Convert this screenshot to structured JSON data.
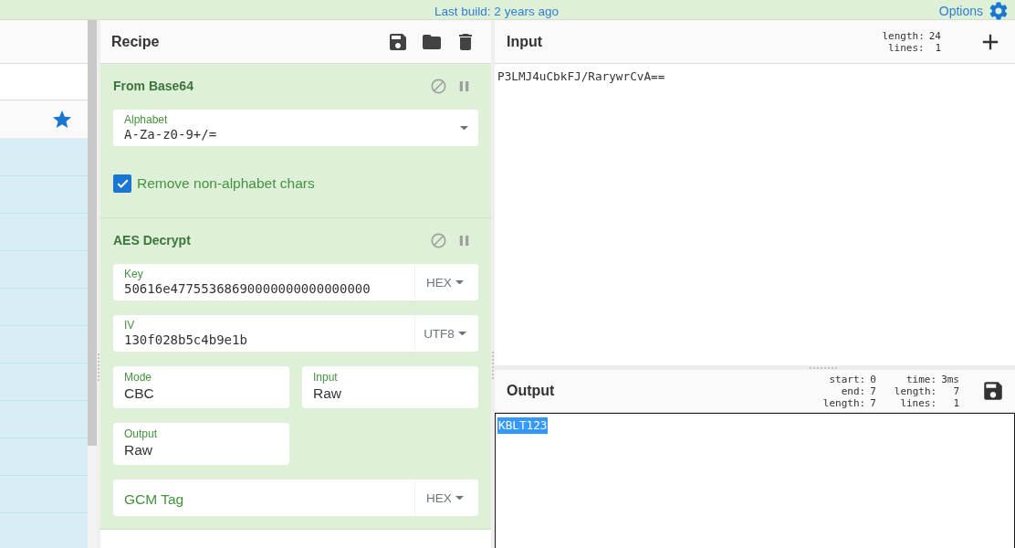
{
  "banner": {
    "build_info": "Last build: 2 years ago",
    "options_label": "Options"
  },
  "recipe": {
    "title": "Recipe",
    "operations": [
      {
        "name": "From Base64",
        "args": [
          {
            "kind": "editable_option",
            "label": "Alphabet",
            "value": "A-Za-z0-9+/="
          },
          {
            "kind": "checkbox",
            "label": "Remove non-alphabet chars",
            "checked": true
          }
        ]
      },
      {
        "name": "AES Decrypt",
        "args": [
          {
            "kind": "toggle_string",
            "label": "Key",
            "value": "50616e47755368690000000000000000",
            "format": "HEX"
          },
          {
            "kind": "toggle_string",
            "label": "IV",
            "value": "130f028b5c4b9e1b",
            "format": "UTF8"
          },
          {
            "kind": "option",
            "label": "Mode",
            "value": "CBC"
          },
          {
            "kind": "option",
            "label": "Input",
            "value": "Raw"
          },
          {
            "kind": "option",
            "label": "Output",
            "value": "Raw"
          },
          {
            "kind": "toggle_string",
            "placeholder": "GCM Tag",
            "format": "HEX"
          }
        ]
      }
    ]
  },
  "input": {
    "title": "Input",
    "stats": [
      [
        {
          "label": "length:",
          "value": "24"
        },
        {
          "label": "lines:",
          "value": "1"
        }
      ]
    ],
    "value": "P3LMJ4uCbkFJ/RarywrCvA=="
  },
  "output": {
    "title": "Output",
    "stats": [
      [
        {
          "label": "start:",
          "value": "0"
        },
        {
          "label": "end:",
          "value": "7"
        },
        {
          "label": "length:",
          "value": "7"
        }
      ],
      [
        {
          "label": "time:",
          "value": "3ms"
        },
        {
          "label": "length:",
          "value": "7"
        },
        {
          "label": "lines:",
          "value": "1"
        }
      ]
    ],
    "value": "KBLT123",
    "selected": true
  }
}
